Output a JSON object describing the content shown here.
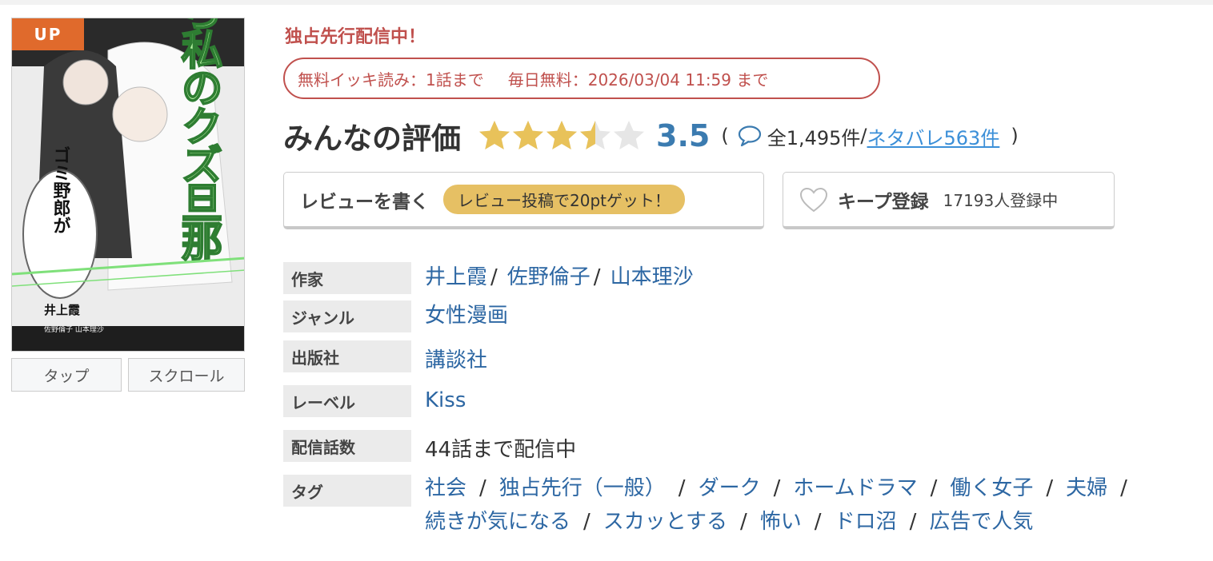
{
  "cover": {
    "badge": "UP",
    "title_vertical": "さよなら私のクズ旦那",
    "speech": "ゴミ野郎が",
    "author": "井上霞",
    "sub_authors": "佐野倫子 山本理沙",
    "buttons": {
      "tap": "タップ",
      "scroll": "スクロール"
    }
  },
  "exclusive": "独占先行配信中！",
  "free_info": {
    "binge": "無料イッキ読み：1話まで",
    "daily": "毎日無料：2026/03/04 11:59 まで"
  },
  "rating": {
    "title": "みんなの評価",
    "score": "3.5",
    "score_value": 3.5,
    "max_stars": 5,
    "open_paren": "(",
    "total": "全1,495件",
    "slash": "/",
    "spoiler": "ネタバレ563件",
    "close_paren": ")",
    "star_color": "#e8c25a",
    "empty_star_color": "#e6e6e6"
  },
  "review_button": {
    "label": "レビューを書く",
    "bonus": "レビュー投稿で20ptゲット！"
  },
  "keep_button": {
    "label": "キープ登録",
    "count": "17193人登録中"
  },
  "info": {
    "author_label": "作家",
    "authors": [
      "井上霞",
      "佐野倫子",
      "山本理沙"
    ],
    "author_sep": "/",
    "genre_label": "ジャンル",
    "genre": "女性漫画",
    "publisher_label": "出版社",
    "publisher": "講談社",
    "label_label": "レーベル",
    "label": "Kiss",
    "episodes_label": "配信話数",
    "episodes": "44話まで配信中",
    "tags_label": "タグ",
    "tags_line1": [
      "社会",
      "独占先行（一般）",
      "ダーク",
      "ホームドラマ",
      "働く女子",
      "夫婦"
    ],
    "tags_line2": [
      "続きが気になる",
      "スカッとする",
      "怖い",
      "ドロ沼",
      "広告で人気"
    ],
    "tag_sep": "/"
  },
  "colors": {
    "accent_red": "#c0504d",
    "link_blue": "#2d67a3",
    "score_blue": "#3b7bb0",
    "badge_orange": "#e06a2c"
  }
}
